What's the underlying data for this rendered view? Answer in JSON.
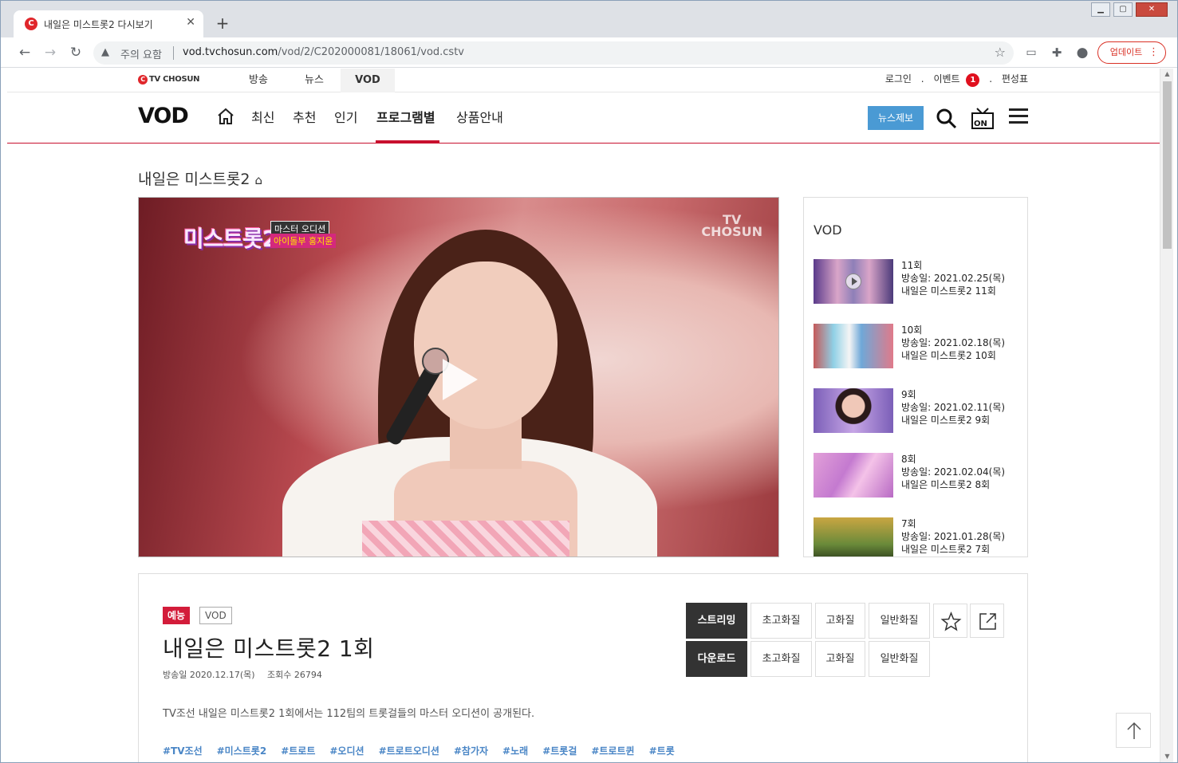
{
  "browser": {
    "tab_title": "내일은 미스트롯2 다시보기",
    "tab_favicon": "C",
    "new_tab": "+",
    "security_label": "주의 요함",
    "url_host": "vod.tvchosun.com",
    "url_path": "/vod/2/C202000081/18061/vod.cstv",
    "update_label": "업데이트",
    "colors": {
      "accent": "#d93025",
      "tab_bg": "#dee1e6"
    }
  },
  "site": {
    "logo_small": "TV CHOSUN",
    "top_nav": [
      "방송",
      "뉴스",
      "VOD"
    ],
    "top_links": {
      "login": "로그인",
      "event": "이벤트",
      "event_badge": "1",
      "schedule": "편성표",
      "sep": "."
    },
    "vod_logo": "VOD",
    "main_nav": [
      "최신",
      "추천",
      "인기",
      "프로그램별",
      "상품안내"
    ],
    "news_report": "뉴스제보",
    "brand_color": "#c8102e"
  },
  "program": {
    "title": "내일은 미스트롯2",
    "player": {
      "show_logo": "미스트롯2",
      "caption_1": "마스터 오디션",
      "caption_2": "아이돌부 홍지윤",
      "watermark_1": "TV",
      "watermark_2": "CHOSUN"
    }
  },
  "sidebar": {
    "title": "VOD",
    "episodes": [
      {
        "ep": "11회",
        "date": "방송일: 2021.02.25(목)",
        "name": "내일은 미스트롯2 11회"
      },
      {
        "ep": "10회",
        "date": "방송일: 2021.02.18(목)",
        "name": "내일은 미스트롯2 10회"
      },
      {
        "ep": "9회",
        "date": "방송일: 2021.02.11(목)",
        "name": "내일은 미스트롯2 9회"
      },
      {
        "ep": "8회",
        "date": "방송일: 2021.02.04(목)",
        "name": "내일은 미스트롯2 8회"
      },
      {
        "ep": "7회",
        "date": "방송일: 2021.01.28(목)",
        "name": "내일은 미스트롯2 7회"
      }
    ]
  },
  "detail": {
    "genre": "예능",
    "type_tag": "VOD",
    "title": "내일은 미스트롯2 1회",
    "air_date": "방송일 2020.12.17(목)",
    "views": "조회수 26794",
    "description": "TV조선 내일은 미스트롯2 1회에서는 112팀의 트롯걸들의 마스터 오디션이 공개된다.",
    "tags": [
      "#TV조선",
      "#미스트롯2",
      "#트로트",
      "#오디션",
      "#트로트오디션",
      "#참가자",
      "#노래",
      "#트롯걸",
      "#트로트퀸",
      "#트롯"
    ],
    "streaming": {
      "label": "스트리밍",
      "options": [
        "초고화질",
        "고화질",
        "일반화질"
      ]
    },
    "download": {
      "label": "다운로드",
      "options": [
        "초고화질",
        "고화질",
        "일반화질"
      ]
    }
  }
}
